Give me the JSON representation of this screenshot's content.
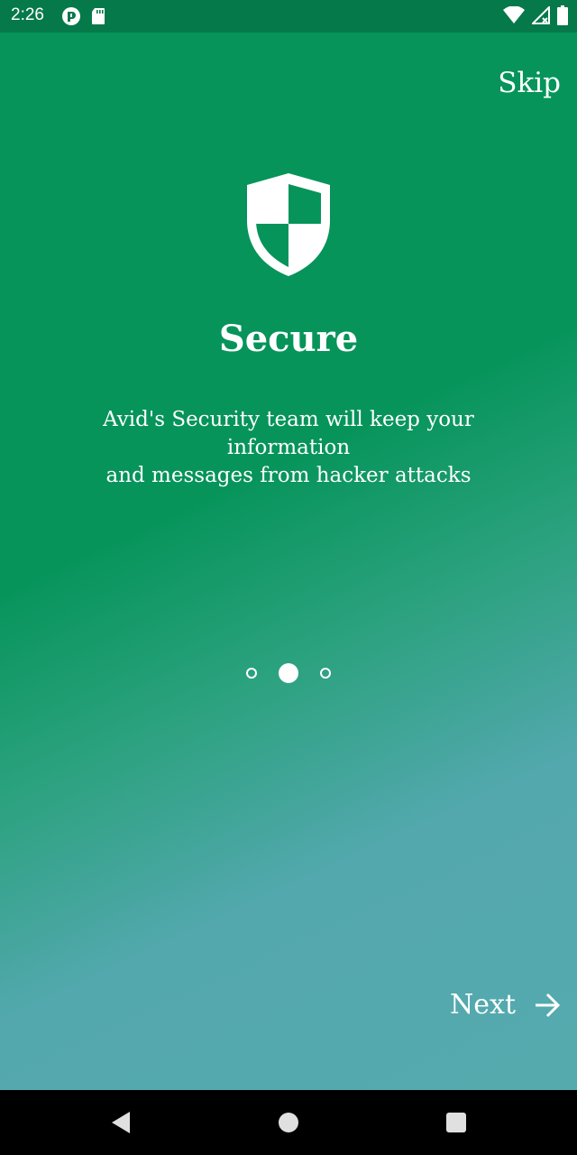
{
  "status_bar": {
    "time": "2:26",
    "icons": [
      "app-notification-icon",
      "sd-card-icon",
      "wifi-icon",
      "signal-icon",
      "battery-icon"
    ]
  },
  "onboarding": {
    "skip_label": "Skip",
    "icon": "shield-icon",
    "title": "Secure",
    "description_line1": "Avid's Security team will keep your information",
    "description_line2": "and messages from hacker attacks",
    "page_indicator": {
      "total": 3,
      "current": 2
    },
    "next_label": "Next",
    "next_icon": "arrow-right-icon"
  },
  "nav_bar": {
    "buttons": [
      "back-icon",
      "home-icon",
      "recents-icon"
    ]
  },
  "colors": {
    "status_bar_bg": "#06794a",
    "gradient_top": "#06945a",
    "gradient_bottom": "#55aaae",
    "text": "#ffffff",
    "nav_bar_bg": "#000000"
  }
}
